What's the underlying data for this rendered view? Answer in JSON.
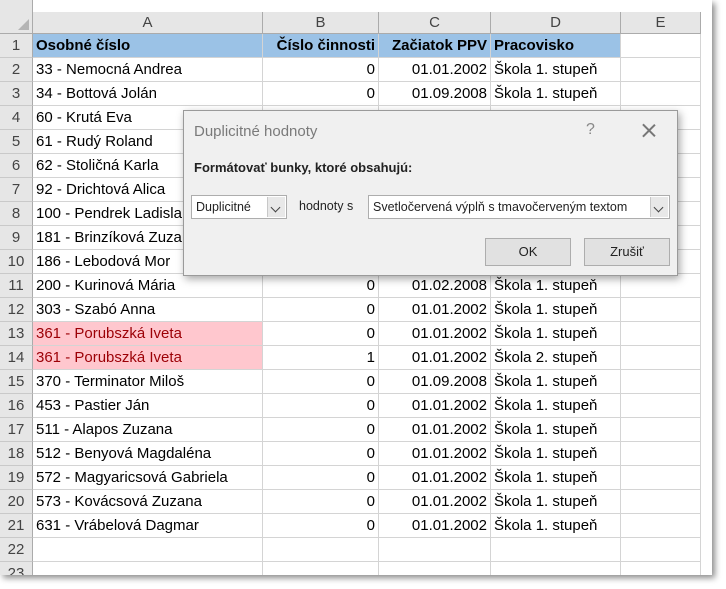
{
  "columns": [
    "A",
    "B",
    "C",
    "D",
    "E"
  ],
  "rows": [
    {
      "num": "1",
      "a": "Osobné číslo",
      "b": "Číslo činnosti",
      "c": "Začiatok PPV",
      "d": "Pracovisko",
      "style": "hdr"
    },
    {
      "num": "2",
      "a": "33 - Nemocná Andrea",
      "b": "0",
      "c": "01.01.2002",
      "d": "Škola 1. stupeň"
    },
    {
      "num": "3",
      "a": "34 - Bottová Jolán",
      "b": "0",
      "c": "01.09.2008",
      "d": "Škola 1. stupeň"
    },
    {
      "num": "4",
      "a": "60 - Krutá Eva",
      "b": "",
      "c": "",
      "d": ""
    },
    {
      "num": "5",
      "a": "61 - Rudý Roland",
      "b": "",
      "c": "",
      "d": ""
    },
    {
      "num": "6",
      "a": "62 - Stoličná Karla",
      "b": "",
      "c": "",
      "d": ""
    },
    {
      "num": "7",
      "a": "92 - Drichtová Alica",
      "b": "",
      "c": "",
      "d": ""
    },
    {
      "num": "8",
      "a": "100 - Pendrek Ladisla",
      "b": "",
      "c": "",
      "d": ""
    },
    {
      "num": "9",
      "a": "181 - Brinzíková Zuza",
      "b": "",
      "c": "",
      "d": ""
    },
    {
      "num": "10",
      "a": "186 - Lebodová Mor",
      "b": "",
      "c": "",
      "d": ""
    },
    {
      "num": "11",
      "a": "200 - Kurinová Mária",
      "b": "0",
      "c": "01.02.2008",
      "d": "Škola 1. stupeň"
    },
    {
      "num": "12",
      "a": "303 - Szabó Anna",
      "b": "0",
      "c": "01.01.2002",
      "d": "Škola 1. stupeň"
    },
    {
      "num": "13",
      "a": "361 - Porubszká Iveta",
      "b": "0",
      "c": "01.01.2002",
      "d": "Škola 1. stupeň",
      "style": "dup"
    },
    {
      "num": "14",
      "a": "361 - Porubszká Iveta",
      "b": "1",
      "c": "01.01.2002",
      "d": "Škola 2. stupeň",
      "style": "dup"
    },
    {
      "num": "15",
      "a": "370 - Terminator Miloš",
      "b": "0",
      "c": "01.09.2008",
      "d": "Škola 1. stupeň"
    },
    {
      "num": "16",
      "a": "453 - Pastier Ján",
      "b": "0",
      "c": "01.01.2002",
      "d": "Škola 1. stupeň"
    },
    {
      "num": "17",
      "a": "511 - Alapos Zuzana",
      "b": "0",
      "c": "01.01.2002",
      "d": "Škola 1. stupeň"
    },
    {
      "num": "18",
      "a": "512 - Benyová Magdaléna",
      "b": "0",
      "c": "01.01.2002",
      "d": "Škola 1. stupeň"
    },
    {
      "num": "19",
      "a": "572 - Magyaricsová Gabriela",
      "b": "0",
      "c": "01.01.2002",
      "d": "Škola 1. stupeň"
    },
    {
      "num": "20",
      "a": "573 - Kovácsová Zuzana",
      "b": "0",
      "c": "01.01.2002",
      "d": "Škola 1. stupeň"
    },
    {
      "num": "21",
      "a": "631 - Vrábelová Dagmar",
      "b": "0",
      "c": "01.01.2002",
      "d": "Škola 1. stupeň"
    },
    {
      "num": "22",
      "a": "",
      "b": "",
      "c": "",
      "d": ""
    },
    {
      "num": "23",
      "a": "",
      "b": "",
      "c": "",
      "d": ""
    }
  ],
  "dialog": {
    "title": "Duplicitné hodnoty",
    "help": "?",
    "prompt": "Formátovať bunky, ktoré obsahujú:",
    "type_value": "Duplicitné",
    "with_label": "hodnoty s",
    "format_value": "Svetločervená výplň s tmavočerveným textom",
    "ok_label": "OK",
    "cancel_label": "Zrušiť"
  },
  "colors": {
    "header_fill": "#9bc2e6",
    "duplicate_fill": "#ffc7ce",
    "duplicate_text": "#9c0006"
  }
}
